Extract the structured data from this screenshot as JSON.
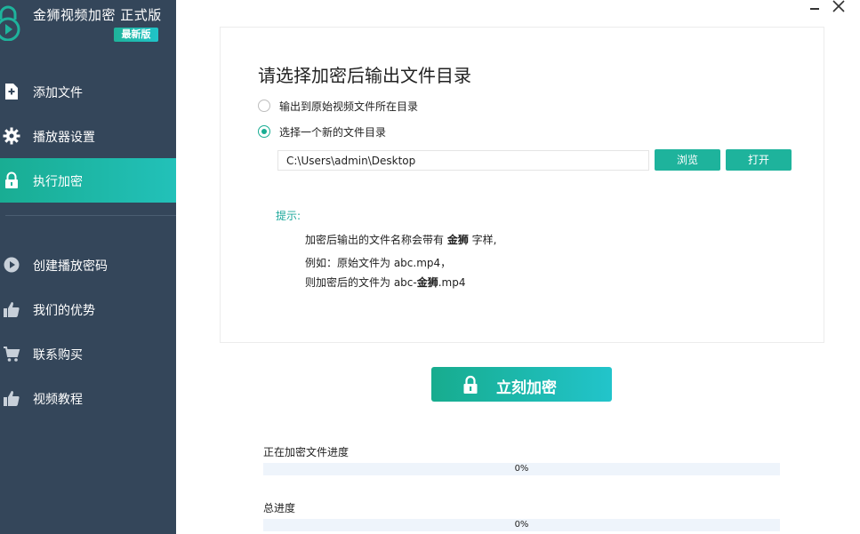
{
  "app": {
    "title": "金狮视频加密 正式版",
    "badge": "最新版"
  },
  "sidebar": {
    "items": [
      {
        "label": "添加文件",
        "icon": "add-file-icon"
      },
      {
        "label": "播放器设置",
        "icon": "gear-icon"
      },
      {
        "label": "执行加密",
        "icon": "lock-icon",
        "active": true
      },
      {
        "label": "创建播放密码",
        "icon": "play-circle-icon"
      },
      {
        "label": "我们的优势",
        "icon": "thumbs-up-icon"
      },
      {
        "label": "联系购买",
        "icon": "cart-icon"
      },
      {
        "label": "视频教程",
        "icon": "thumbs-up-icon"
      }
    ]
  },
  "panel": {
    "title": "请选择加密后输出文件目录",
    "options": [
      {
        "label": "输出到原始视频文件所在目录",
        "checked": false
      },
      {
        "label": "选择一个新的文件目录",
        "checked": true
      }
    ],
    "path_value": "C:\\Users\\admin\\Desktop",
    "browse_label": "浏览",
    "open_label": "打开",
    "tip": {
      "title": "提示:",
      "line1_a": "加密后输出的文件名称会带有 ",
      "line1_b": "金狮",
      "line1_c": " 字样,",
      "line2": "例如：原始文件为 abc.mp4，",
      "line3_a": "则加密后的文件为 abc-",
      "line3_b": "金狮",
      "line3_c": ".mp4"
    }
  },
  "encrypt_button": {
    "label": "立刻加密"
  },
  "progress": {
    "current": {
      "label": "正在加密文件进度",
      "value": 0,
      "text": "0%"
    },
    "total": {
      "label": "总进度",
      "value": 0,
      "text": "0%"
    }
  },
  "colors": {
    "sidebar_bg": "#34465a",
    "accent": "#1eb39c",
    "accent_end": "#22c4cb"
  }
}
